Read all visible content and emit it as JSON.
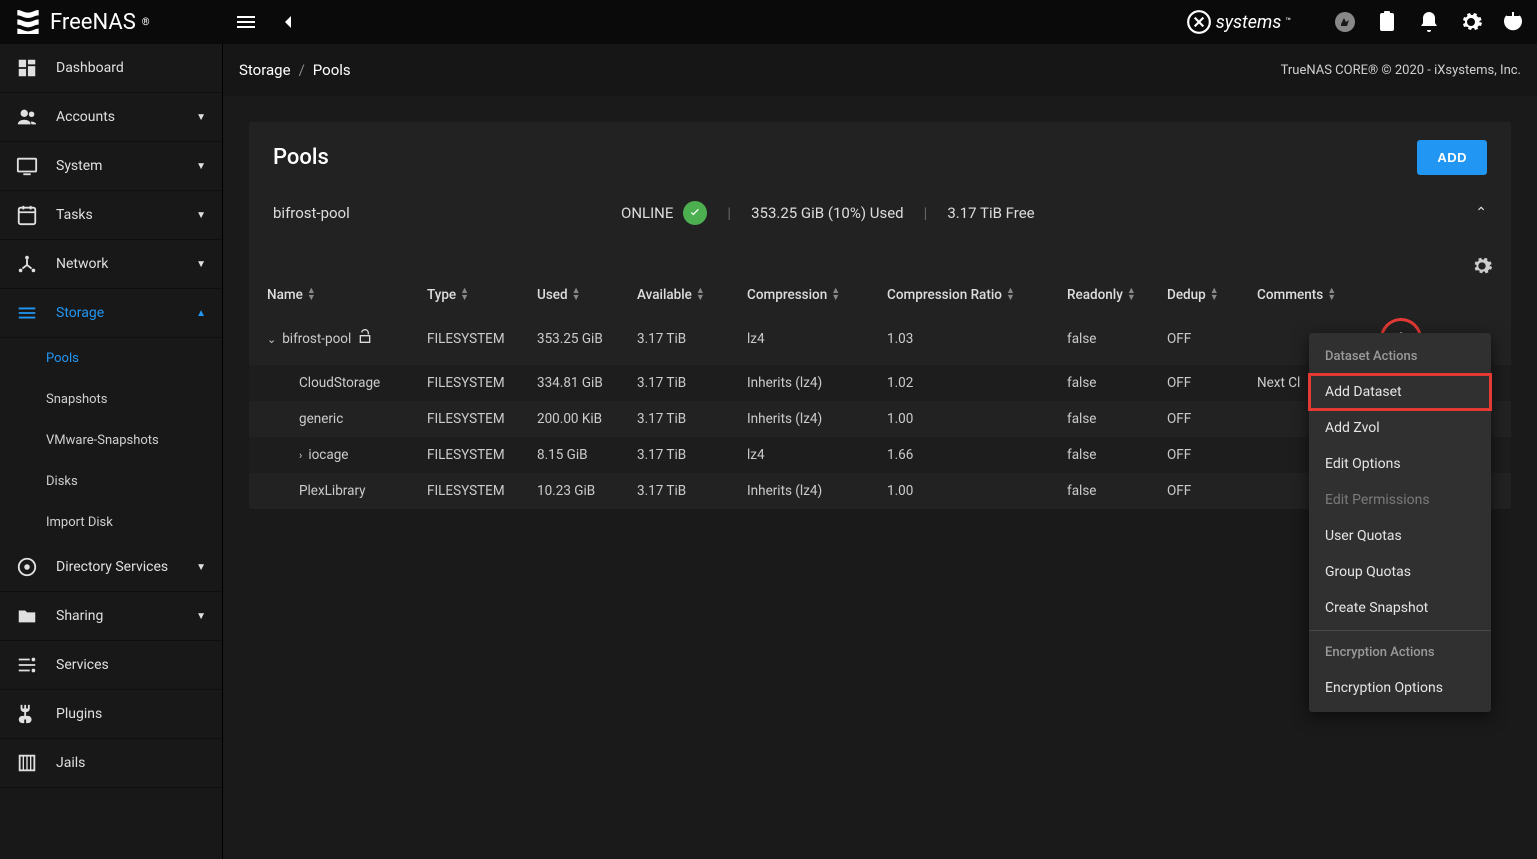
{
  "brand": "FreeNAS",
  "ixbrand": "systems",
  "breadcrumb": {
    "root": "Storage",
    "leaf": "Pools"
  },
  "copyright": "TrueNAS CORE® © 2020 - iXsystems, Inc.",
  "sidebar": {
    "dashboard": "Dashboard",
    "accounts": "Accounts",
    "system": "System",
    "tasks": "Tasks",
    "network": "Network",
    "storage": "Storage",
    "storage_children": {
      "pools": "Pools",
      "snapshots": "Snapshots",
      "vmware": "VMware-Snapshots",
      "disks": "Disks",
      "import": "Import Disk"
    },
    "directory": "Directory Services",
    "sharing": "Sharing",
    "services": "Services",
    "plugins": "Plugins",
    "jails": "Jails"
  },
  "card": {
    "title": "Pools",
    "add_label": "ADD"
  },
  "pool": {
    "name": "bifrost-pool",
    "status": "ONLINE",
    "used": "353.25 GiB (10%) Used",
    "free": "3.17 TiB Free"
  },
  "columns": {
    "name": "Name",
    "type": "Type",
    "used": "Used",
    "available": "Available",
    "compression": "Compression",
    "ratio": "Compression Ratio",
    "readonly": "Readonly",
    "dedup": "Dedup",
    "comments": "Comments"
  },
  "rows": [
    {
      "name": "bifrost-pool",
      "indent": 0,
      "exp": "down",
      "lock": true,
      "type": "FILESYSTEM",
      "used": "353.25 GiB",
      "avail": "3.17 TiB",
      "comp": "lz4",
      "ratio": "1.03",
      "ro": "false",
      "dedup": "OFF",
      "comments": "",
      "dots": true
    },
    {
      "name": "CloudStorage",
      "indent": 1,
      "type": "FILESYSTEM",
      "used": "334.81 GiB",
      "avail": "3.17 TiB",
      "comp": "Inherits (lz4)",
      "ratio": "1.02",
      "ro": "false",
      "dedup": "OFF",
      "comments": "Next Cl"
    },
    {
      "name": "generic",
      "indent": 1,
      "type": "FILESYSTEM",
      "used": "200.00 KiB",
      "avail": "3.17 TiB",
      "comp": "Inherits (lz4)",
      "ratio": "1.00",
      "ro": "false",
      "dedup": "OFF",
      "comments": ""
    },
    {
      "name": "iocage",
      "indent": 1,
      "exp": "right",
      "type": "FILESYSTEM",
      "used": "8.15 GiB",
      "avail": "3.17 TiB",
      "comp": "lz4",
      "ratio": "1.66",
      "ro": "false",
      "dedup": "OFF",
      "comments": ""
    },
    {
      "name": "PlexLibrary",
      "indent": 1,
      "type": "FILESYSTEM",
      "used": "10.23 GiB",
      "avail": "3.17 TiB",
      "comp": "Inherits (lz4)",
      "ratio": "1.00",
      "ro": "false",
      "dedup": "OFF",
      "comments": ""
    }
  ],
  "menu": {
    "section1": "Dataset Actions",
    "add_dataset": "Add Dataset",
    "add_zvol": "Add Zvol",
    "edit_options": "Edit Options",
    "edit_perms": "Edit Permissions",
    "user_quotas": "User Quotas",
    "group_quotas": "Group Quotas",
    "create_snapshot": "Create Snapshot",
    "section2": "Encryption Actions",
    "enc_options": "Encryption Options"
  }
}
